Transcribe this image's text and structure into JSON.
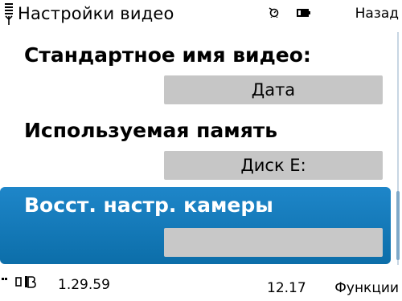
{
  "statusbar": {
    "title": "Настройки видео",
    "back_label": "Назад"
  },
  "settings": [
    {
      "label": "Стандартное имя видео:",
      "value": "Дата"
    },
    {
      "label": "Используемая память",
      "value": "Диск E:"
    },
    {
      "label": "Восст. настр. камеры",
      "value": ""
    }
  ],
  "bottombar": {
    "elapsed": "1.29.59",
    "remaining": "12.17",
    "functions_label": "Функции"
  },
  "colors": {
    "selection": "#1178b9",
    "value_box": "#c6c6c6"
  }
}
